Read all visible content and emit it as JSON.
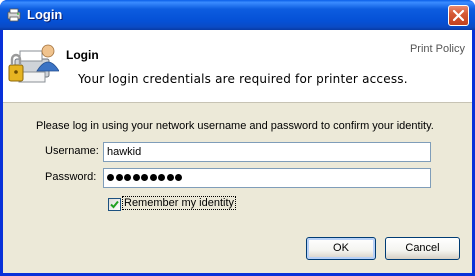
{
  "window": {
    "title": "Login",
    "icons": {
      "app": "printer-app-icon",
      "close": "close-icon"
    }
  },
  "header": {
    "title": "Login",
    "description": "Your login credentials are required for printer access.",
    "link": "Print Policy",
    "icon": "printer-lock-user-icon"
  },
  "form": {
    "instructions": "Please log in using your network username and password to confirm your identity.",
    "username_label": "Username:",
    "username_value": "hawkid",
    "password_label": "Password:",
    "password_length": 9,
    "remember_label": "Remember my identity",
    "remember_checked": true
  },
  "buttons": {
    "ok": "OK",
    "cancel": "Cancel"
  },
  "colors": {
    "titlebar": "#0551d6",
    "client": "#ece9d8",
    "header_bg": "#ffffff",
    "close": "#d65a36"
  }
}
